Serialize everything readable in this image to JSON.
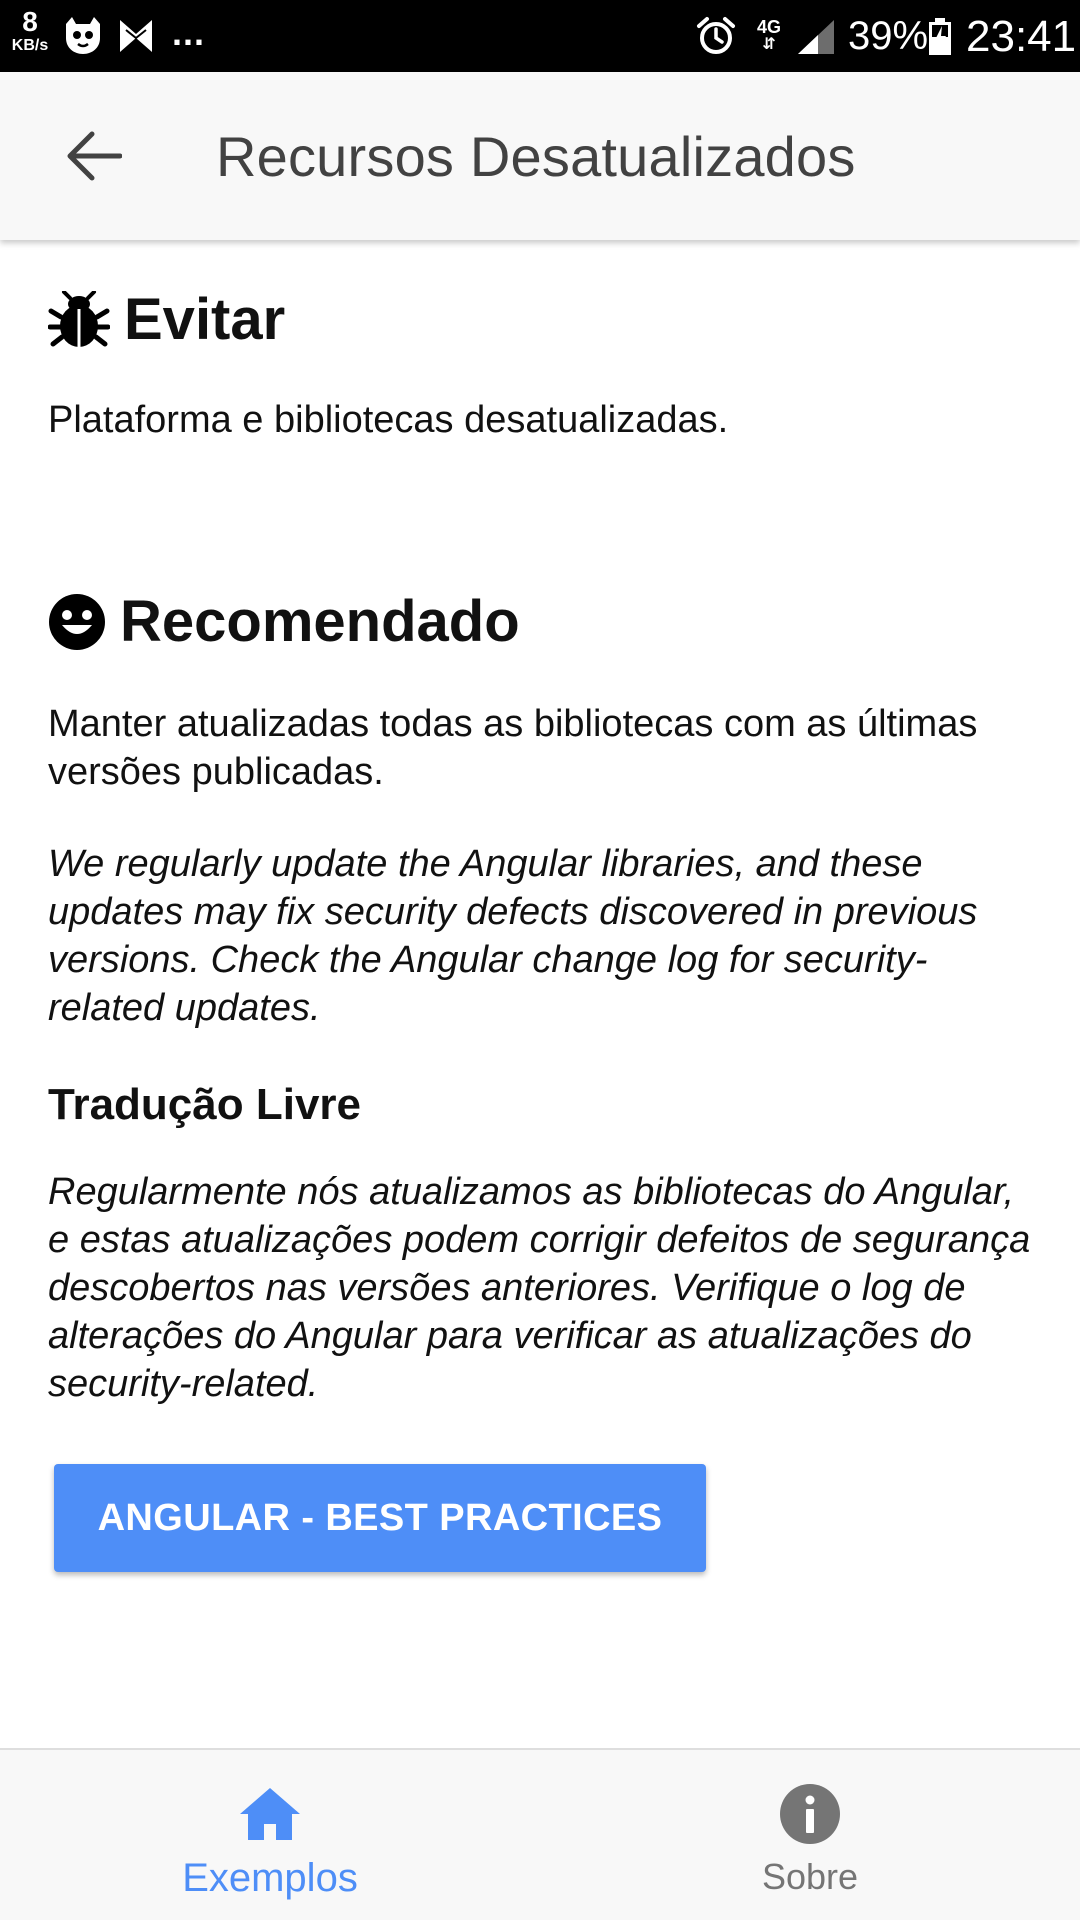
{
  "status_bar": {
    "net_speed": "8",
    "net_speed_unit": "KB/s",
    "more": "...",
    "network_type": "4G",
    "network_arrows": "⇵",
    "battery_percent": "39%",
    "time": "23:41",
    "icons": [
      "ghost-app-icon",
      "m-app-icon",
      "alarm-icon",
      "signal-icon",
      "battery-charging-icon"
    ]
  },
  "app_bar": {
    "back_icon": "arrow-left-icon",
    "title": "Recursos Desatualizados"
  },
  "content": {
    "avoid": {
      "icon": "bug-icon",
      "heading": "Evitar",
      "text": "Plataforma e bibliotecas desatualizadas."
    },
    "recommended": {
      "icon": "smiley-icon",
      "heading": "Recomendado",
      "text": "Manter atualizadas todas as bibliotecas com as últimas versões publicadas.",
      "quote_en": "We regularly update the Angular libraries, and these updates may fix security defects discovered in previous versions. Check the Angular change log for security-related updates."
    },
    "translation": {
      "heading": "Tradução Livre",
      "text": "Regularmente nós atualizamos as bibliotecas do Angular, e estas atualizações podem corrigir defeitos de segurança descobertos nas versões anteriores. Verifique o log de alterações do Angular para verificar as atualizações do security-related."
    },
    "cta_label": "ANGULAR - BEST PRACTICES"
  },
  "tabs": [
    {
      "label": "Exemplos",
      "icon": "home-icon",
      "active": true
    },
    {
      "label": "Sobre",
      "icon": "info-icon",
      "active": false
    }
  ],
  "colors": {
    "accent": "#4e8ef7",
    "inactive_tab": "#757575",
    "app_bar_bg": "#f8f8f8",
    "status_bar_bg": "#000000"
  }
}
